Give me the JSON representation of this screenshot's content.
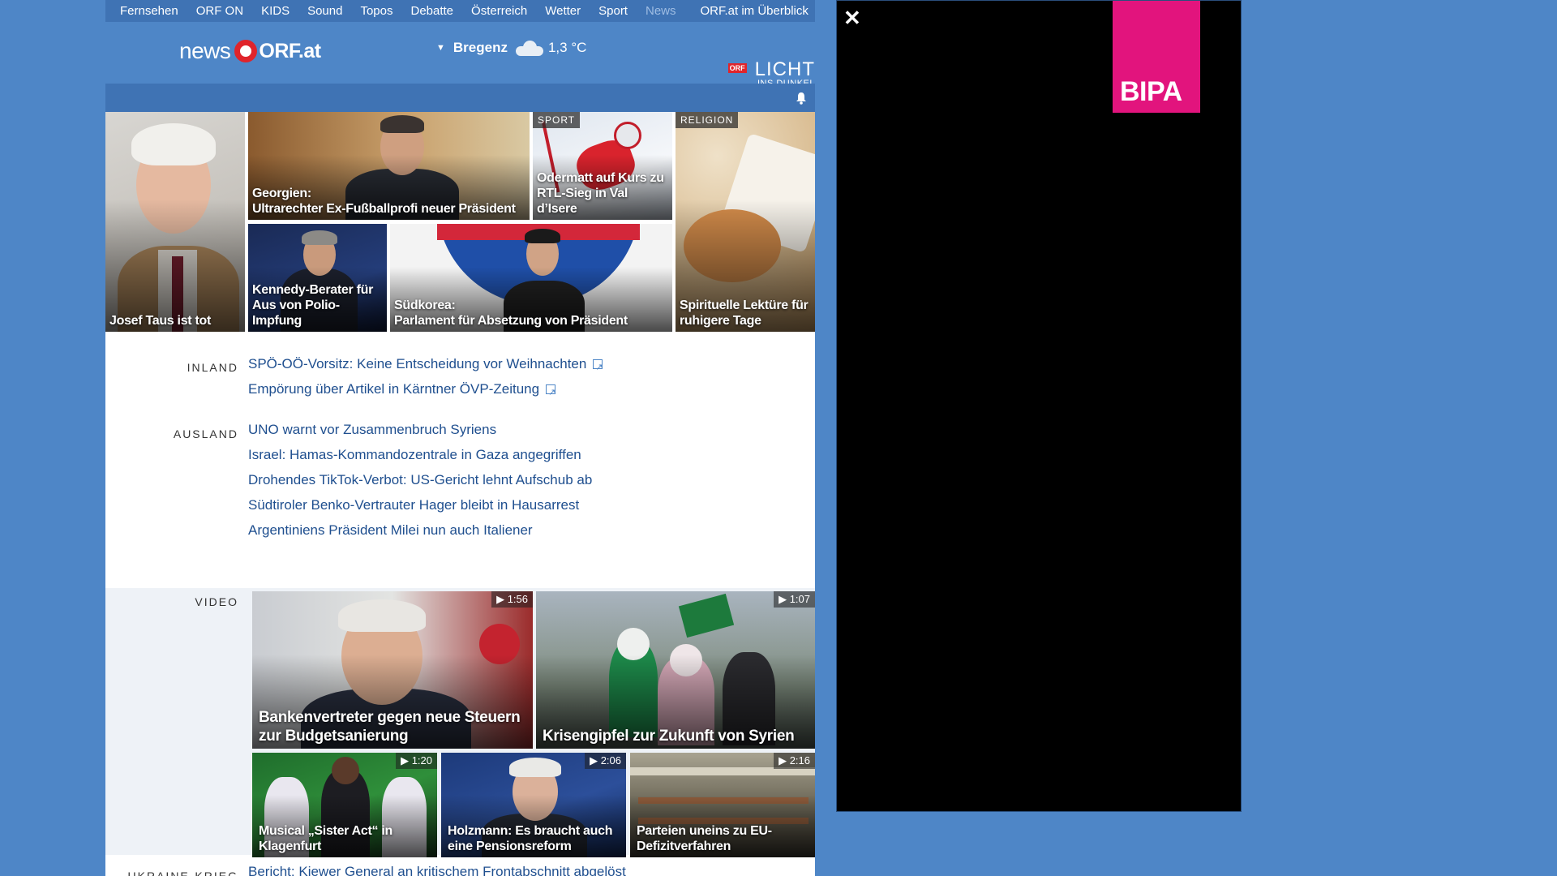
{
  "topnav": {
    "items": [
      "Fernsehen",
      "ORF ON",
      "KIDS",
      "Sound",
      "Topos",
      "Debatte",
      "Österreich",
      "Wetter",
      "Sport",
      "News"
    ],
    "overview": "ORF.at im Überblick"
  },
  "masthead": {
    "logo_news": "news",
    "logo_orf": "ORF.at",
    "weather_city": "Bregenz",
    "weather_temp": "1,3 °C",
    "weather_icon": "cloud-icon",
    "licht_badge": "ORF",
    "licht_title": "LICHT",
    "licht_sub": "INS DUNKEL"
  },
  "tiles": [
    {
      "caption": "Josef Taus ist tot",
      "tag": ""
    },
    {
      "caption": "Georgien:\nUltrarechter Ex-Fußballprofi neuer Präsident",
      "tag": ""
    },
    {
      "caption": "Odermatt auf Kurs zu RTL-Sieg in Val d’Isere",
      "tag": "SPORT"
    },
    {
      "caption": "Spirituelle Lektüre für ruhigere Tage",
      "tag": "RELIGION"
    },
    {
      "caption": "Kennedy-Berater für Aus von Polio-Impfung",
      "tag": ""
    },
    {
      "caption": "Südkorea:\nParlament für Absetzung von Präsident",
      "tag": ""
    }
  ],
  "inland": {
    "label": "INLAND",
    "items": [
      "SPÖ-OÖ-Vorsitz: Keine Entscheidung vor Weihnachten",
      "Empörung über Artikel in Kärntner ÖVP-Zeitung"
    ]
  },
  "ausland": {
    "label": "AUSLAND",
    "items": [
      "UNO warnt vor Zusammenbruch Syriens",
      "Israel: Hamas-Kommandozentrale in Gaza angegriffen",
      "Drohendes TikTok-Verbot: US-Gericht lehnt Aufschub ab",
      "Südtiroler Benko-Vertrauter Hager bleibt in Hausarrest",
      "Argentiniens Präsident Milei nun auch Italiener"
    ]
  },
  "video": {
    "label": "VIDEO",
    "items": [
      {
        "caption": "Bankenvertreter gegen neue Steuern zur Budgetsanierung",
        "duration": "▶ 1:56"
      },
      {
        "caption": "Krisengipfel zur Zukunft von Syrien",
        "duration": "▶ 1:07"
      },
      {
        "caption": "Musical „Sister Act“ in Klagenfurt",
        "duration": "▶ 1:20"
      },
      {
        "caption": "Holzmann: Es braucht auch eine Pensionsreform",
        "duration": "▶ 2:06"
      },
      {
        "caption": "Parteien uneins zu EU-Defizitverfahren",
        "duration": "▶ 2:16"
      }
    ]
  },
  "ukraine": {
    "label": "UKRAINE-KRIEG",
    "items": [
      "Bericht: Kiewer General an kritischem Frontabschnitt abgelöst"
    ]
  },
  "ad": {
    "close": "✕",
    "brand": "BIPA"
  }
}
